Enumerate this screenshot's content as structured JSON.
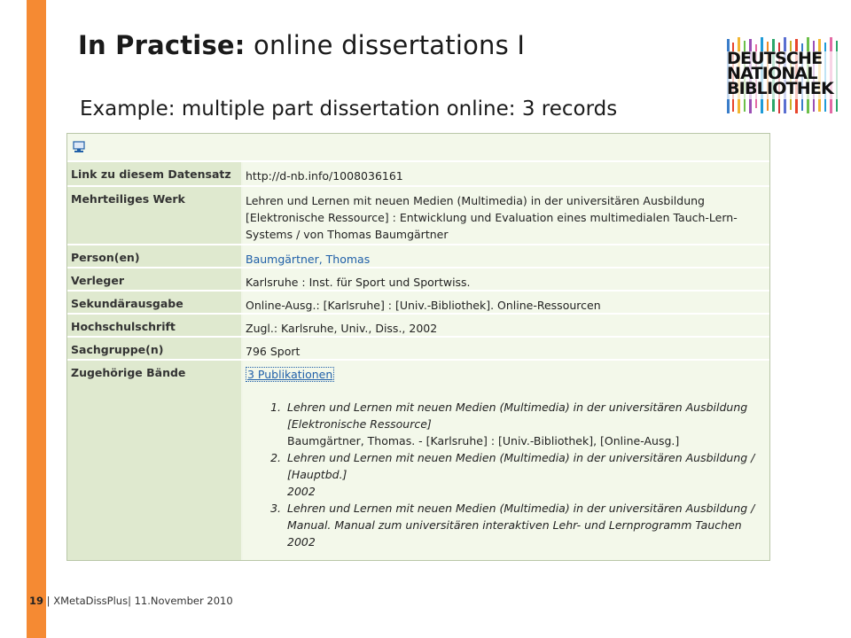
{
  "slide": {
    "title_bold": "In Practise:",
    "title_rest": " online dissertations I",
    "subtitle": "Example: multiple part dissertation online: 3 records",
    "logo": {
      "line1": "DEUTSCHE",
      "line2": "NATIONAL",
      "line3": "BIBLIOTHEK"
    },
    "accent_color": "#f58a33"
  },
  "record": {
    "icon": "computer-icon",
    "rows": [
      {
        "label": "Link zu diesem Datensatz",
        "value": "http://d-nb.info/1008036161"
      },
      {
        "label": "Mehrteiliges Werk",
        "value": "Lehren und Lernen mit neuen Medien (Multimedia) in der universitären Ausbildung [Elektronische Ressource] : Entwicklung und Evaluation eines multimedialen Tauch-Lern-Systems / von Thomas Baumgärtner"
      },
      {
        "label": "Person(en)",
        "value": "Baumgärtner, Thomas"
      },
      {
        "label": "Verleger",
        "value": "Karlsruhe : Inst. für Sport und Sportwiss."
      },
      {
        "label": "Sekundärausgabe",
        "value": "Online-Ausg.: [Karlsruhe] : [Univ.-Bibliothek]. Online-Ressourcen"
      },
      {
        "label": "Hochschulschrift",
        "value": "Zugl.: Karlsruhe, Univ., Diss., 2002"
      },
      {
        "label": "Sachgruppe(n)",
        "value": "796 Sport"
      },
      {
        "label": "Zugehörige Bände",
        "value": "3 Publikationen"
      }
    ],
    "publications": [
      {
        "title": "Lehren und Lernen mit neuen Medien (Multimedia) in der universitären Ausbildung [Elektronische Ressource]",
        "detail": "Baumgärtner, Thomas. - [Karlsruhe] : [Univ.-Bibliothek], [Online-Ausg.]"
      },
      {
        "title": "Lehren und Lernen mit neuen Medien (Multimedia) in der universitären Ausbildung / [Hauptbd.]",
        "detail": "2002"
      },
      {
        "title": "Lehren und Lernen mit neuen Medien (Multimedia) in der universitären Ausbildung / Manual. Manual zum universitären interaktiven Lehr- und Lernprogramm Tauchen",
        "detail": "2002"
      }
    ]
  },
  "footer": {
    "page_number": "19",
    "text": " | XMetaDissPlus| 11.November 2010"
  }
}
